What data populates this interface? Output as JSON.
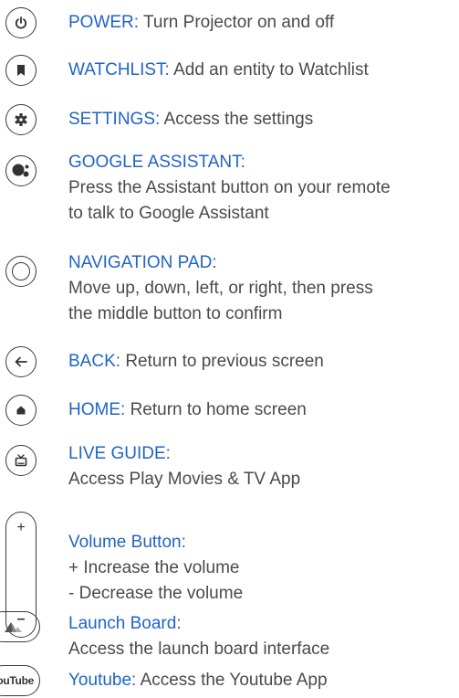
{
  "items": [
    {
      "label": "POWER:",
      "desc": "Turn Projector on and off",
      "icon": "power-icon"
    },
    {
      "label": "WATCHLIST:",
      "desc": "Add an entity to Watchlist",
      "icon": "bookmark-icon"
    },
    {
      "label": "SETTINGS:",
      "desc": "Access the settings",
      "icon": "gear-icon"
    },
    {
      "label": "GOOGLE ASSISTANT:",
      "desc_lines": [
        "Press the Assistant button on your remote",
        "to talk to Google Assistant"
      ],
      "icon": "google-assistant-icon"
    },
    {
      "label": "NAVIGATION PAD:",
      "desc_lines": [
        "Move up, down, left, or right, then press",
        "the middle button to confirm"
      ],
      "icon": "navigation-pad-icon"
    },
    {
      "label": "BACK:",
      "desc": "Return to previous screen",
      "icon": "back-arrow-icon"
    },
    {
      "label": "HOME:",
      "desc": "Return to home screen",
      "icon": "home-icon"
    },
    {
      "label": "LIVE GUIDE:",
      "desc_lines": [
        "Access Play Movies & TV App"
      ],
      "icon": "tv-icon"
    },
    {
      "label": "Volume Button:",
      "desc_lines": [
        "+ Increase the volume",
        "- Decrease the volume"
      ],
      "icon": "volume-rocker-icon"
    },
    {
      "label": "Launch Board:",
      "desc_lines": [
        "Access the launch board interface"
      ],
      "icon": "launch-board-icon"
    },
    {
      "label": "Youtube:",
      "desc": "Access the Youtube App",
      "icon": "youtube-icon"
    }
  ],
  "volume": {
    "plus": "+",
    "minus": "–"
  },
  "youtube_badge": "YouTube"
}
